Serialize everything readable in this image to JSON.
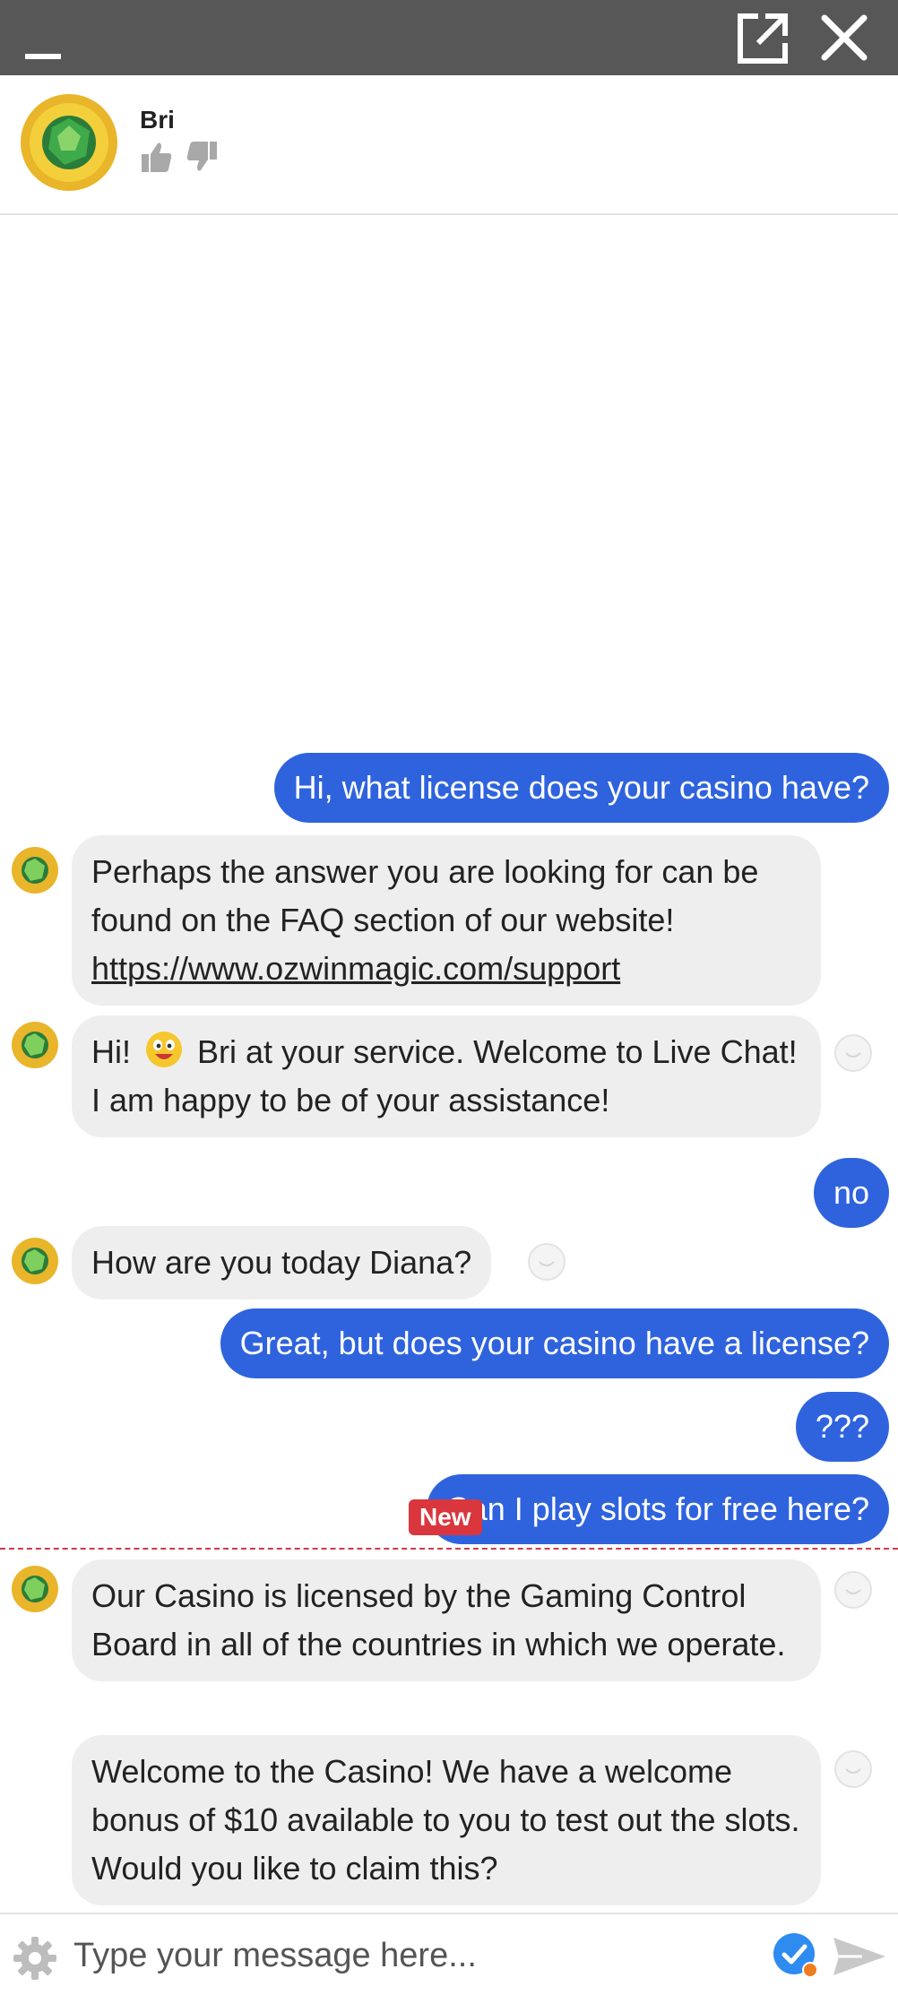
{
  "agent": {
    "name": "Bri"
  },
  "messages": [
    {
      "text": "Hi, what license does your casino have?"
    },
    {
      "text": "Perhaps the answer you are looking for can be found on the FAQ section of our website!",
      "link": "https://www.ozwinmagic.com/support"
    },
    {
      "before": "Hi!",
      "after": "Bri at your service. Welcome to Live Chat! I am happy to be of your assistance!"
    },
    {
      "text": "no"
    },
    {
      "text": "How are you today Diana?"
    },
    {
      "text": "Great, but does your casino have a license?"
    },
    {
      "text": "???"
    },
    {
      "text": "Can I play slots for free here?"
    },
    {
      "text": "Our Casino is licensed by the Gaming Control Board in all of the countries in which we operate."
    },
    {
      "text": "Welcome to the Casino! We have a welcome bonus of $10 available to you to test out the slots. Would you like to claim this?"
    }
  ],
  "new_badge": "New",
  "composer": {
    "placeholder": "Type your message here..."
  },
  "colors": {
    "titlebar": "#575757",
    "user_bubble": "#2f63de",
    "bot_bubble": "#eeeeee",
    "new_marker": "#d9363e"
  },
  "icons": [
    "minimize-icon",
    "popout-icon",
    "close-icon",
    "thumbs-up-icon",
    "thumbs-down-icon",
    "smiley-icon",
    "emoji-grin-icon",
    "gear-icon",
    "verified-check-icon",
    "send-icon"
  ]
}
